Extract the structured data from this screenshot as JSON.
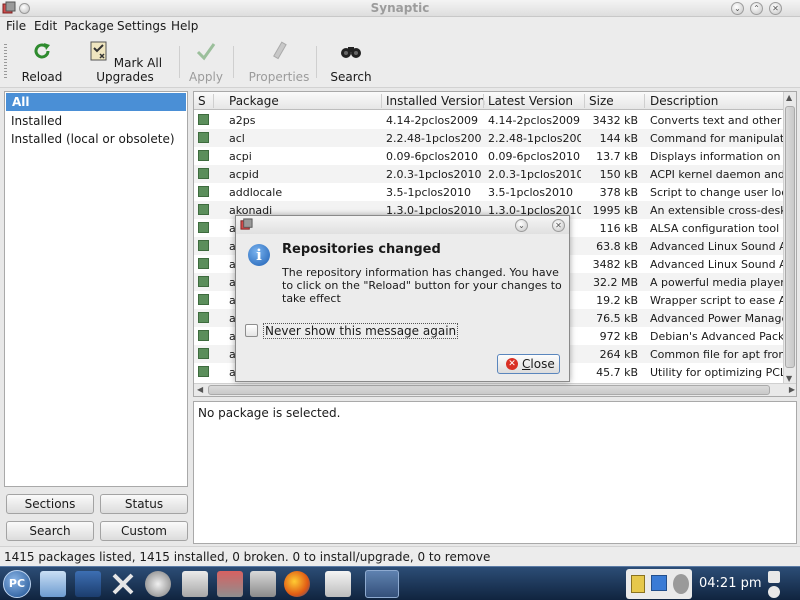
{
  "window": {
    "title": "Synaptic",
    "controls": [
      "chevron-down-icon",
      "chevron-up-icon",
      "close-icon"
    ]
  },
  "menu": [
    "File",
    "Edit",
    "Package",
    "Settings",
    "Help"
  ],
  "toolbar": {
    "reload": "Reload",
    "mark_all": "Mark All Upgrades",
    "apply": "Apply",
    "properties": "Properties",
    "search": "Search"
  },
  "filters": {
    "items": [
      "All",
      "Installed",
      "Installed (local or obsolete)"
    ],
    "selected": "All"
  },
  "filter_buttons": {
    "sections": "Sections",
    "status": "Status",
    "search": "Search",
    "custom": "Custom"
  },
  "packages": {
    "columns": [
      "S",
      "Package",
      "Installed Version",
      "Latest Version",
      "Size",
      "Description"
    ],
    "rows": [
      {
        "name": "a2ps",
        "installed": "4.14-2pclos2009",
        "latest": "4.14-2pclos2009",
        "size": "3432 kB",
        "desc": "Converts text and other"
      },
      {
        "name": "acl",
        "installed": "2.2.48-1pclos2009",
        "latest": "2.2.48-1pclos2009",
        "size": "144 kB",
        "desc": "Command for manipulati"
      },
      {
        "name": "acpi",
        "installed": "0.09-6pclos2010",
        "latest": "0.09-6pclos2010",
        "size": "13.7 kB",
        "desc": "Displays information on A"
      },
      {
        "name": "acpid",
        "installed": "2.0.3-1pclos2010",
        "latest": "2.0.3-1pclos2010",
        "size": "150 kB",
        "desc": "ACPI kernel daemon and"
      },
      {
        "name": "addlocale",
        "installed": "3.5-1pclos2010",
        "latest": "3.5-1pclos2010",
        "size": "378 kB",
        "desc": "Script to change user loc"
      },
      {
        "name": "akonadi",
        "installed": "1.3.0-1pclos2010",
        "latest": "1.3.0-1pclos2010",
        "size": "1995 kB",
        "desc": "An extensible cross-desk"
      },
      {
        "name": "a",
        "installed": "",
        "latest": "10",
        "size": "116 kB",
        "desc": "ALSA configuration tool"
      },
      {
        "name": "a",
        "installed": "",
        "latest": "10",
        "size": "63.8 kB",
        "desc": "Advanced Linux Sound A"
      },
      {
        "name": "a",
        "installed": "",
        "latest": "10",
        "size": "3482 kB",
        "desc": "Advanced Linux Sound A"
      },
      {
        "name": "a",
        "installed": "",
        "latest": "10",
        "size": "32.2 MB",
        "desc": "A powerful media player"
      },
      {
        "name": "a",
        "installed": "",
        "latest": "09",
        "size": "19.2 kB",
        "desc": "Wrapper script to ease A"
      },
      {
        "name": "a",
        "installed": "",
        "latest": "10",
        "size": "76.5 kB",
        "desc": "Advanced Power Manage"
      },
      {
        "name": "a",
        "installed": "",
        "latest": "2-2|",
        "size": "972 kB",
        "desc": "Debian's Advanced Packa"
      },
      {
        "name": "a",
        "installed": "",
        "latest": "2-2|",
        "size": "264 kB",
        "desc": "Common file for apt fron"
      },
      {
        "name": "a",
        "installed": "",
        "latest": "",
        "size": "45.7 kB",
        "desc": "Utility for optimizing PCL"
      }
    ]
  },
  "details": "No package is selected.",
  "status": "1415 packages listed, 1415 installed, 0 broken. 0 to install/upgrade, 0 to remove",
  "dialog": {
    "heading": "Repositories changed",
    "message": "The repository information has changed. You have to click on the \"Reload\" button for your changes to take effect",
    "checkbox_label": "Never show this message again",
    "close_label": "Close",
    "close_accel_rest": "lose",
    "close_accel": "C"
  },
  "taskbar": {
    "clock": "04:21 pm",
    "start": "PC"
  },
  "colors": {
    "selection": "#4a8fd6",
    "installed_marker": "#5b8e5b",
    "taskbar": "#1b355a"
  }
}
